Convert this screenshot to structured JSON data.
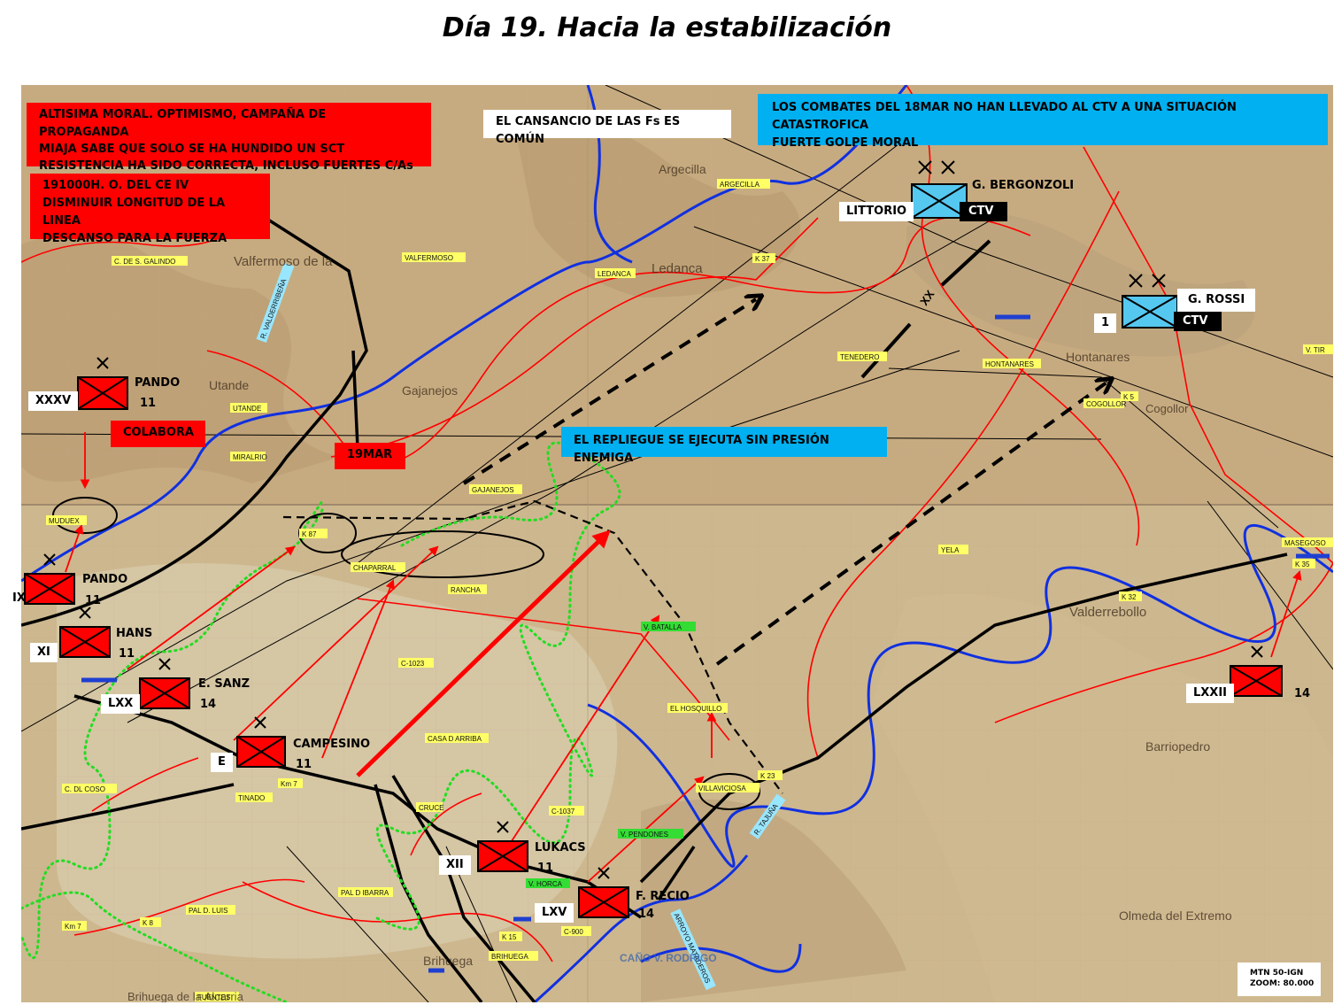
{
  "title": "Día 19. Hacia la estabilización",
  "notes": {
    "moral": [
      "ALTISIMA  MORAL. OPTIMISMO, CAMPAÑA DE PROPAGANDA",
      "MIAJA SABE QUE SOLO SE HA HUNDIDO UN SCT",
      "RESISTENCIA HA SIDO CORRECTA, INCLUSO FUERTES C/As"
    ],
    "order": [
      "191000H. O. DEL CE IV",
      "DISMINUIR LONGITUD DE LA LINEA",
      "DESCANSO PARA LA FUERZA"
    ],
    "fatigue": "EL CANSANCIO DE LAS Fs ES COMÚN",
    "ctv": [
      "LOS COMBATES DEL 18MAR NO HAN LLEVADO AL CTV A UNA SITUACIÓN  CATASTROFICA",
      "FUERTE GOLPE MORAL"
    ],
    "withdrawal": "EL REPLIEGUE SE EJECUTA SIN PRESIÓN ENEMIGA",
    "colabora": "COLABORA",
    "date": "19MAR"
  },
  "units": {
    "xxxv": {
      "id": "XXXV",
      "commander": "PANDO",
      "division": "11"
    },
    "ix": {
      "id": "IX",
      "commander": "PANDO",
      "division": "11"
    },
    "xi": {
      "id": "XI",
      "commander": "HANS",
      "division": "11"
    },
    "lxx": {
      "id": "LXX",
      "commander": "E. SANZ",
      "division": "14"
    },
    "e": {
      "id": "E",
      "commander": "CAMPESINO",
      "division": "11"
    },
    "xii": {
      "id": "XII",
      "commander": "LUKACS",
      "division": "11"
    },
    "lxv": {
      "id": "LXV",
      "commander": "F. RECIO",
      "division": "14"
    },
    "lxxii": {
      "id": "LXXII",
      "division": "14"
    },
    "littorio": {
      "id": "LITTORIO",
      "commander": "G. BERGONZOLI",
      "corps": "CTV"
    },
    "rossi": {
      "id": "1",
      "commander": "G. ROSSI",
      "corps": "CTV"
    },
    "boundary": "XX"
  },
  "places": {
    "argecilla": "ARGECILLA",
    "valfermoso": "VALFERMOSO",
    "ledanca": "LEDANCA",
    "galindo": "C. DE S. GALINDO",
    "utande": "UTANDE",
    "miralrio": "MIRALRIO",
    "gajanejos": "GAJANEJOS",
    "mudujex": "MUDUEX",
    "k87": "K 87",
    "chaparral": "CHAPARRAL",
    "rancha": "RANCHA",
    "batalla": "V. BATALLA",
    "hosquillo": "EL HOSQUILLO",
    "villaviciosa": "VILLAVICIOSA",
    "k23": "K 23",
    "pendones": "V. PENDONES",
    "horca": "V. HORCA",
    "brihuega": "BRIHUEGA",
    "k15": "K 15",
    "c900": "C-900",
    "c1037": "C-1037",
    "c1023": "C-1023",
    "casa_arriba": "CASA D ARRIBA",
    "cruce": "CRUCE",
    "tinado": "TINADO",
    "km7": "Km 7",
    "km7b": "Km 7",
    "k8": "K 8",
    "coso": "C. DL COSO",
    "ibarra": "PAL D IBARRA",
    "luis": "PAL D. LUIS",
    "fuentes": "FUENTES",
    "tenedero": "TENEDERO",
    "hontanares": "HONTANARES",
    "cogollor": "COGOLLOR",
    "k5": "K 5",
    "yela": "YELA",
    "masegoso": "MASEGOSO",
    "k35": "K 35",
    "k32": "K 32",
    "k37": "K 37",
    "tirol": "V. TIR"
  },
  "rivers": {
    "badiel": "R. VALDERRIBEÑA",
    "tajuna": "R. TAJUÑA",
    "arroyo": "ARROYO MATADEROS",
    "rodrigo": "CAÑO V. RODRIGO"
  },
  "map_text": {
    "valfermoso_town": "Valfermoso de la",
    "utande_town": "Utande",
    "gajanejos_town": "Gajanejos",
    "ledanca_town": "Ledanca",
    "hontanares_town": "Hontanares",
    "valderrebollo": "Valderrebollo",
    "barriopedro": "Barriopedro",
    "olmeda": "Olmeda del Extremo",
    "cogollor_town": "Cogollor",
    "argecilla_town": "Argecilla",
    "brihuega_town": "Brihuega",
    "alcarria": "Brihuega de la Alcarria"
  },
  "scale": [
    "MTN 50-IGN",
    "ZOOM: 80.000"
  ],
  "colors": {
    "red": "#ff0000",
    "blue": "#00b0f0",
    "nationalist": "#55c8f0",
    "road_black": "#000000",
    "river": "#1030e0",
    "front_green": "#22dd22"
  }
}
